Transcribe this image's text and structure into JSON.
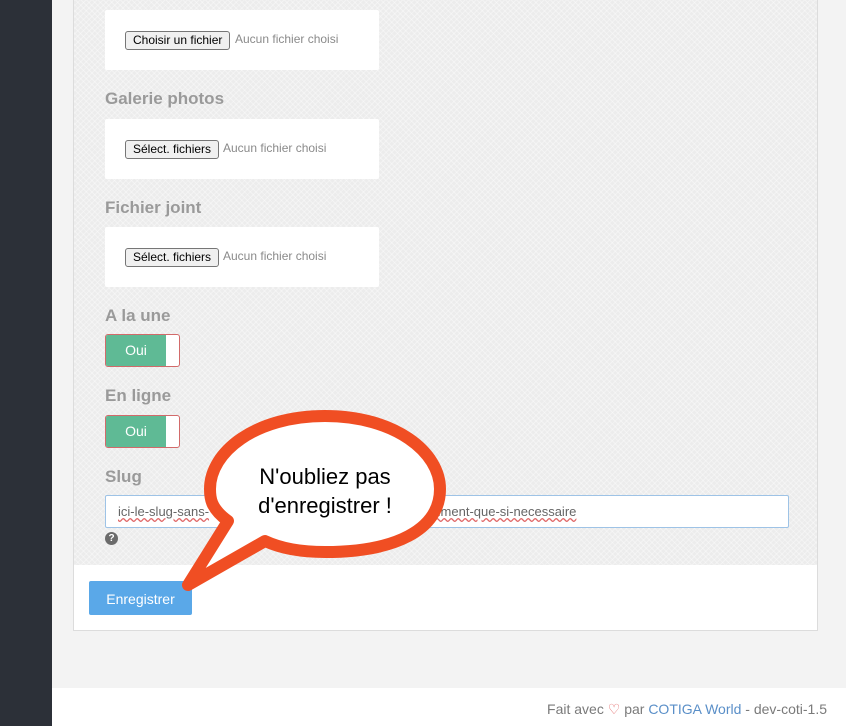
{
  "fields": {
    "image_upload": {
      "button_label": "Choisir un fichier",
      "status": "Aucun fichier choisi"
    },
    "gallery": {
      "label": "Galerie photos",
      "button_label": "Sélect. fichiers",
      "status": "Aucun fichier choisi"
    },
    "attachment": {
      "label": "Fichier joint",
      "button_label": "Sélect. fichiers",
      "status": "Aucun fichier choisi"
    },
    "featured": {
      "label": "A la une",
      "toggle_label": "Oui"
    },
    "online": {
      "label": "En ligne",
      "toggle_label": "Oui"
    },
    "slug": {
      "label": "Slug",
      "value_left": "ici-le-slug-sans-",
      "value_right": "modifier-vraiment-que-si-necessaire",
      "help_icon": "?"
    }
  },
  "actions": {
    "save_label": "Enregistrer"
  },
  "callout": {
    "line1": "N'oubliez pas",
    "line2": "d'enregistrer !"
  },
  "footer": {
    "prefix": "Fait avec",
    "heart_icon": "♡",
    "by": "par",
    "company": "COTIGA World",
    "version": "- dev-coti-1.5"
  },
  "colors": {
    "toggle_on": "#5fba95",
    "save_button": "#5aa8e8",
    "callout_fill": "#f04e23",
    "sidebar": "#2c3038",
    "footer_link": "#5a8fc8"
  }
}
